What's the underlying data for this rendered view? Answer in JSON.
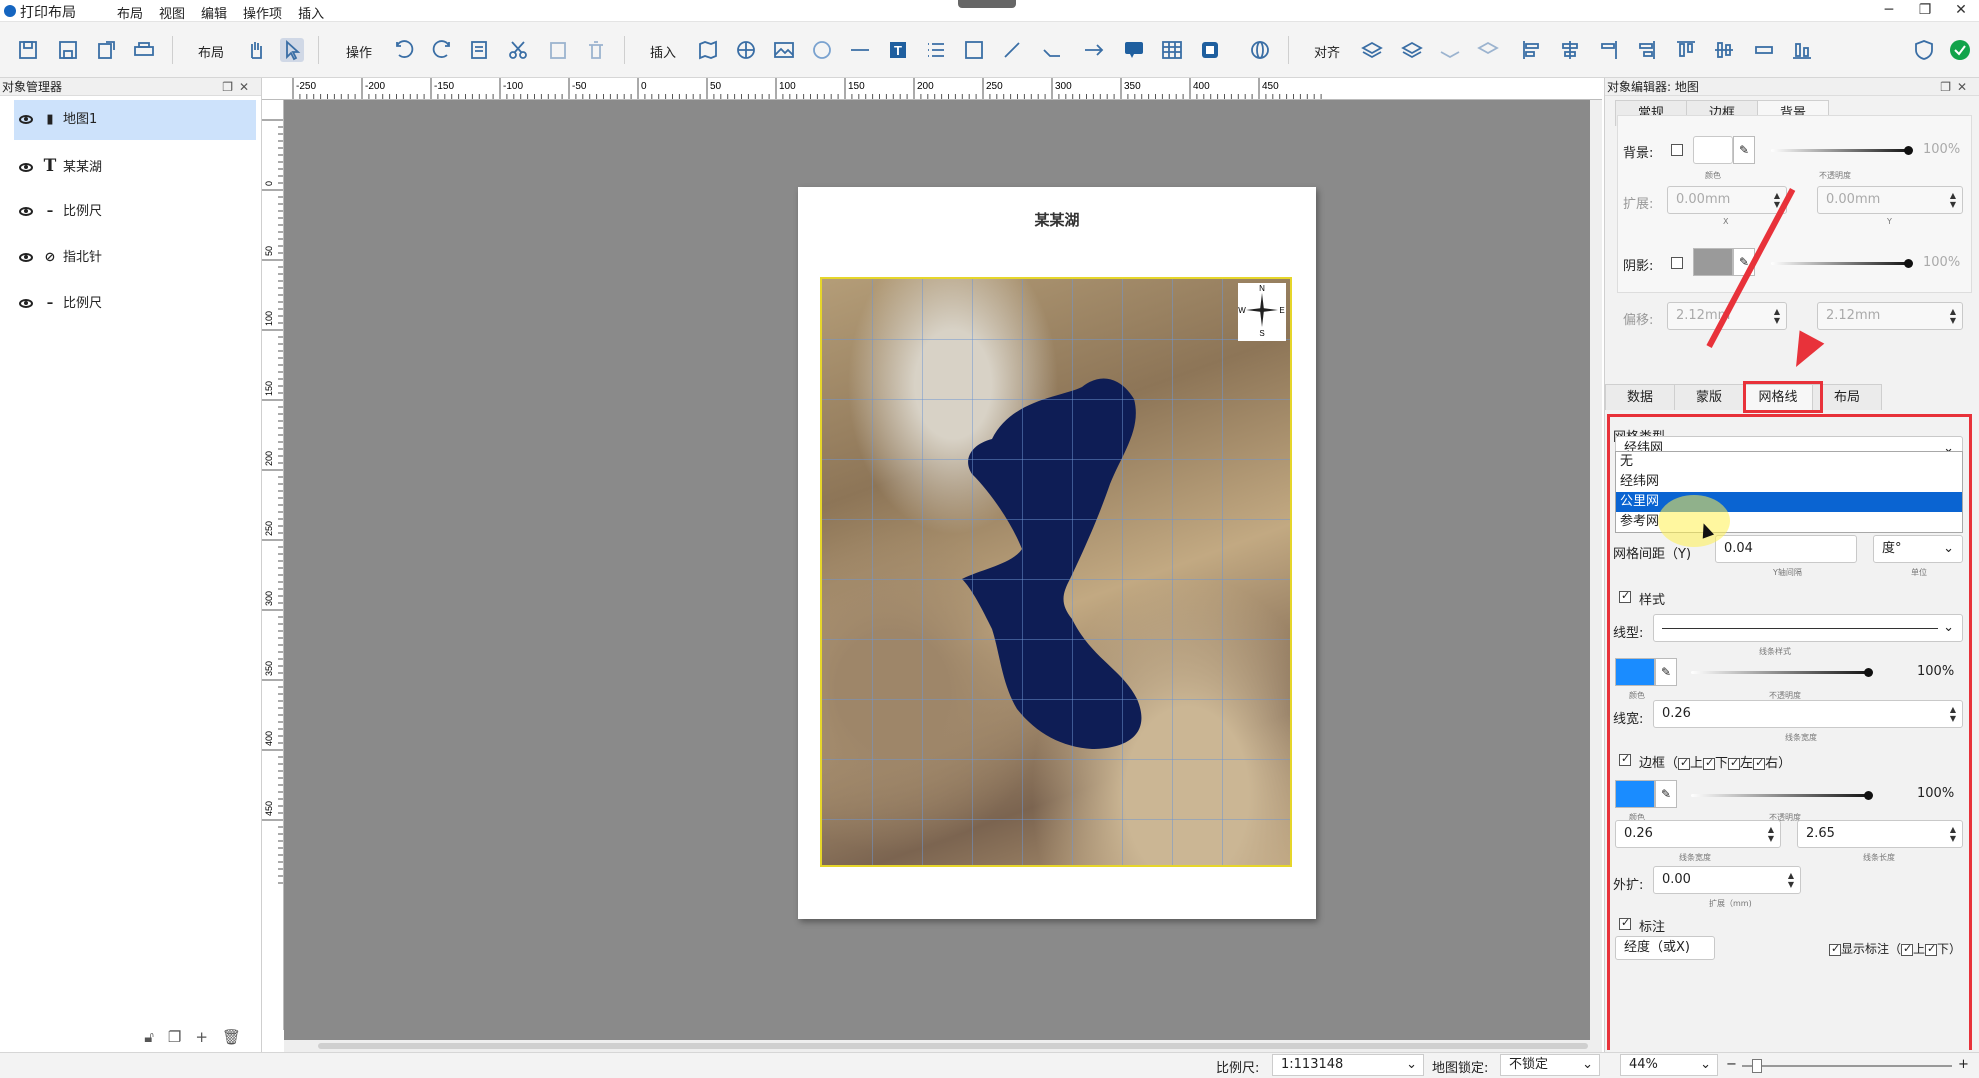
{
  "app": {
    "title": "打印布局",
    "menu": [
      "布局",
      "视图",
      "编辑",
      "操作项",
      "插入"
    ]
  },
  "toolbar": {
    "layout_label": "布局",
    "operation_label": "操作",
    "insert_label": "插入",
    "align_label": "对齐"
  },
  "left_panel": {
    "title": "对象管理器",
    "items": [
      {
        "label": "地图1",
        "icon": "map-icon",
        "selected": true
      },
      {
        "label": "某某湖",
        "icon": "text-icon"
      },
      {
        "label": "比例尺",
        "icon": "scale-bar-icon"
      },
      {
        "label": "指北针",
        "icon": "north-arrow-icon"
      },
      {
        "label": "比例尺",
        "icon": "scale-bar-icon"
      }
    ]
  },
  "ruler": {
    "h_ticks": [
      "-250",
      "-200",
      "-150",
      "-100",
      "-50",
      "0",
      "50",
      "100",
      "150",
      "200",
      "250",
      "300",
      "350",
      "400",
      "450"
    ],
    "v_ticks": [
      "0",
      "50",
      "100",
      "150",
      "200",
      "250",
      "300",
      "350",
      "400",
      "450"
    ]
  },
  "page": {
    "map_title": "某某湖"
  },
  "right_panel": {
    "title": "对象编辑器: 地图",
    "tabs": [
      "常规",
      "边框",
      "背景"
    ],
    "bg": {
      "label": "背景:",
      "color_caption": "颜色",
      "opacity": "100%",
      "opacity_caption": "不透明度",
      "expand_label": "扩展:",
      "expand_x": "0.00mm",
      "expand_y": "0.00mm",
      "x_caption": "X",
      "y_caption": "Y",
      "shadow_label": "阴影:",
      "shadow_opacity": "100%",
      "offset_label": "偏移:",
      "offset_x": "2.12mm",
      "offset_y": "2.12mm"
    },
    "subtabs": [
      "数据",
      "蒙版",
      "网格线",
      "布局"
    ],
    "grid": {
      "type_label": "网格类型",
      "type_value": "经纬网",
      "options": [
        "无",
        "经纬网",
        "公里网",
        "参考网"
      ],
      "highlighted": "公里网",
      "interval_y_label": "网格间距（Y)",
      "interval_y": "0.04",
      "interval_y_caption": "Y轴间隔",
      "unit": "度°",
      "unit_caption": "单位",
      "style_label": "样式",
      "linetype_label": "线型:",
      "linetype_caption": "线条样式",
      "color_caption": "颜色",
      "opacity": "100%",
      "opacity_caption": "不透明度",
      "linewidth_label": "线宽:",
      "linewidth": "0.26",
      "linewidth_caption": "线条宽度",
      "border_label": "边框（",
      "border_top": "上",
      "border_bottom": "下",
      "border_left": "左",
      "border_right": "右）",
      "border_color_caption": "颜色",
      "border_opacity": "100%",
      "border_opacity_caption": "不透明度",
      "border_width": "0.26",
      "border_width_caption": "线条宽度",
      "border_length": "2.65",
      "border_length_caption": "线条长度",
      "extend_label": "外扩:",
      "extend": "0.00",
      "extend_caption": "扩展（mm)",
      "label_label": "标注",
      "coord_value": "经度（或X)",
      "show_label": "显示标注（",
      "show_top": "上",
      "show_bottom": "下）"
    },
    "colors": {
      "grid_line": "#1a8cff",
      "accent_red": "#e8323a"
    }
  },
  "status": {
    "scale_label": "比例尺:",
    "scale_value": "1:113148",
    "lock_label": "地图锁定:",
    "lock_value": "不锁定",
    "zoom": "44%"
  }
}
